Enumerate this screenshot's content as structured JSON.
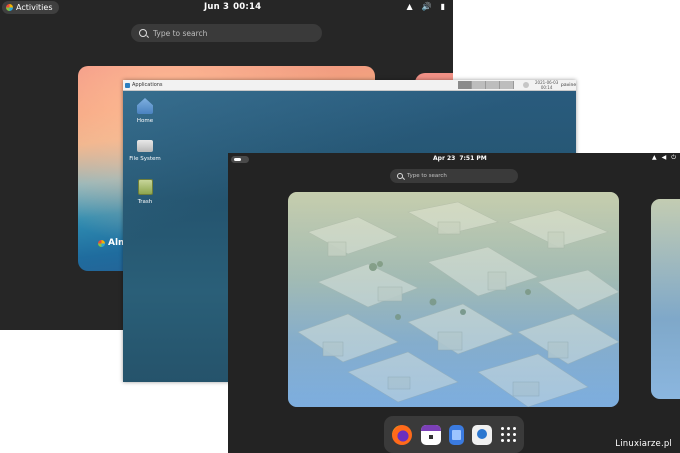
{
  "gnome_top": {
    "activities_label": "Activities",
    "clock_date": "Jun 3",
    "clock_time": "00:14",
    "search_placeholder": "Type to search",
    "logo_text": "Alma"
  },
  "xfce": {
    "applications_label": "Applications",
    "panel_clock_line1": "2021-06-03",
    "panel_clock_line2": "00:14",
    "panel_user": "pavine",
    "desktop_icons": [
      {
        "label": "Home",
        "icon": "home-folder-icon"
      },
      {
        "label": "File System",
        "icon": "drive-icon"
      },
      {
        "label": "Trash",
        "icon": "trash-icon"
      }
    ]
  },
  "fedora": {
    "clock_date": "Apr 23",
    "clock_time": "7:51 PM",
    "search_placeholder": "Type to search",
    "dock_apps": [
      "firefox-icon",
      "calendar-icon",
      "files-icon",
      "software-icon",
      "app-grid-icon"
    ]
  },
  "watermark": "Linuxiarze.pl",
  "colors": {
    "gnome_bg": "#262626",
    "xfce_wallpaper": "#2a5c7f",
    "fedora_bg": "#232323"
  }
}
